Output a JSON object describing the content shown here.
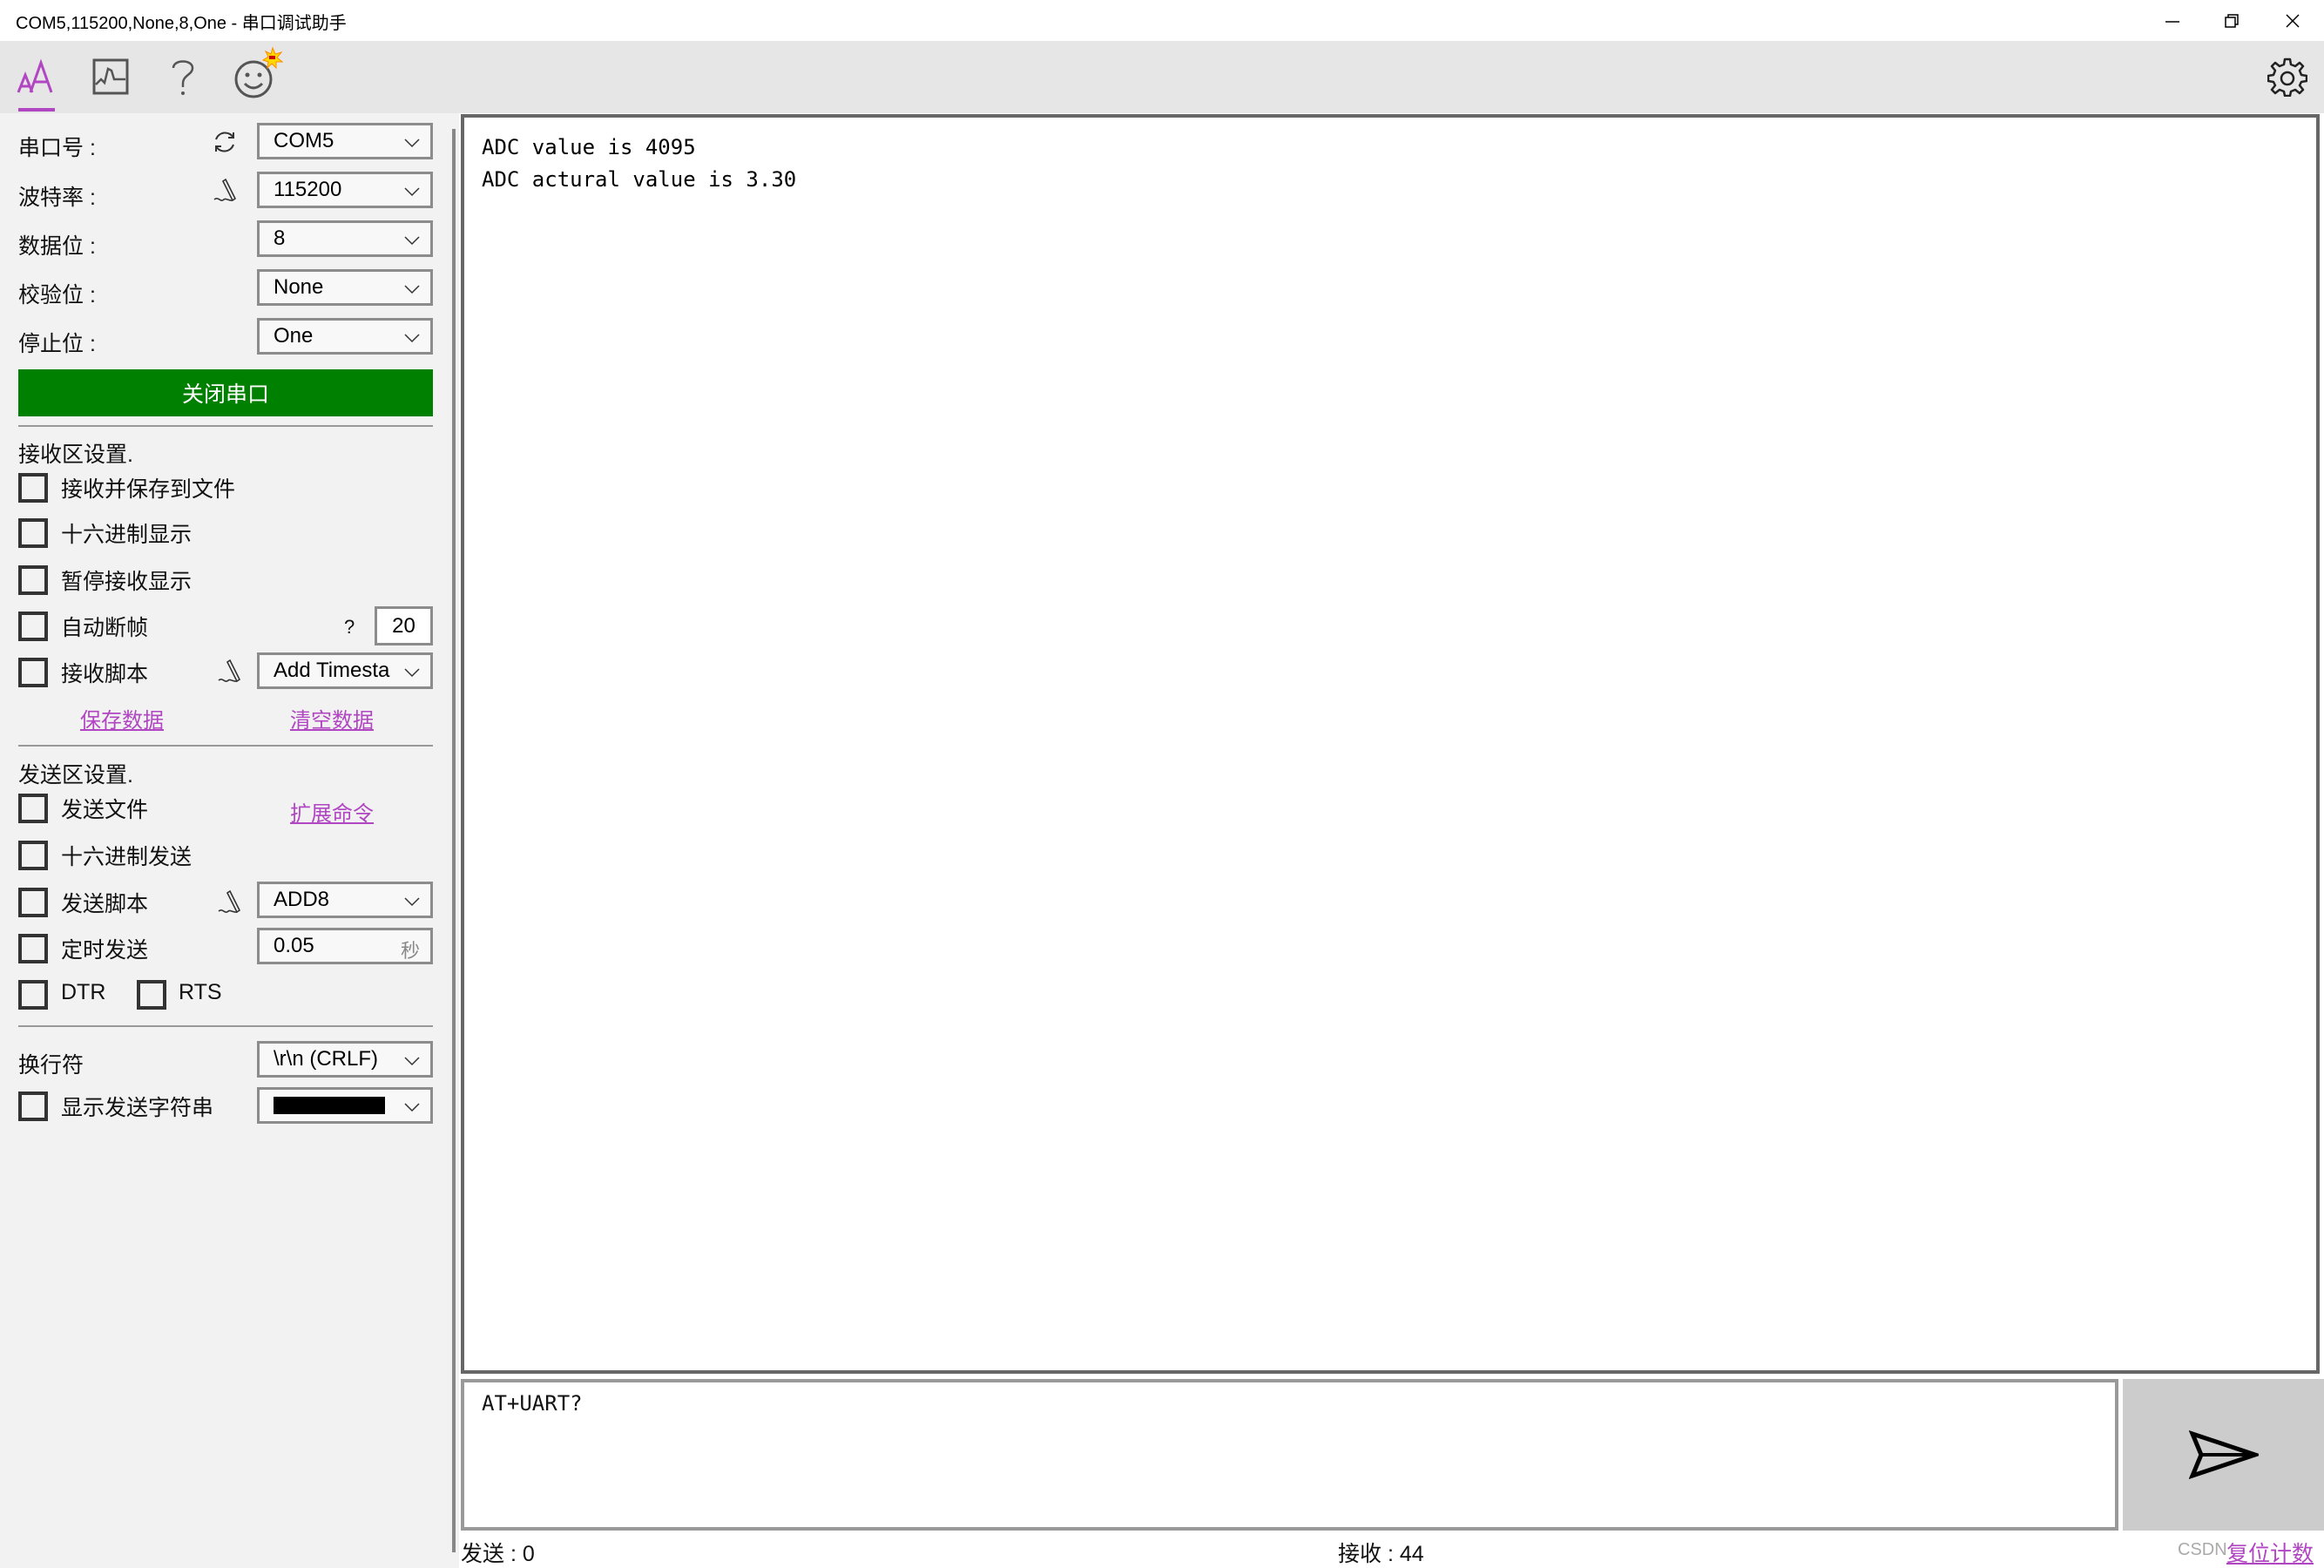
{
  "window": {
    "title": "COM5,115200,None,8,One - 串口调试助手",
    "controls": [
      "minimize",
      "restore",
      "close"
    ]
  },
  "toolbar": {
    "tabs": [
      {
        "name": "text-mode",
        "icon": "font-size-icon",
        "active": true
      },
      {
        "name": "chart-mode",
        "icon": "chart-icon",
        "active": false
      },
      {
        "name": "help",
        "icon": "question-icon",
        "active": false
      },
      {
        "name": "feedback",
        "icon": "smiley-icon",
        "active": false,
        "badge": true
      }
    ],
    "settings_icon": "gear-icon",
    "accent_color": "#b146c2"
  },
  "serial": {
    "port_label": "串口号 :",
    "port_value": "COM5",
    "baud_label": "波特率 :",
    "baud_value": "115200",
    "databits_label": "数据位 :",
    "databits_value": "8",
    "parity_label": "校验位 :",
    "parity_value": "None",
    "stopbits_label": "停止位 :",
    "stopbits_value": "One",
    "toggle_button": "关闭串口",
    "toggle_color": "#008000"
  },
  "receive_settings": {
    "heading": "接收区设置.",
    "save_to_file": "接收并保存到文件",
    "hex_display": "十六进制显示",
    "pause_display": "暂停接收显示",
    "auto_frame": "自动断帧",
    "auto_frame_help": "?",
    "auto_frame_value": "20",
    "script": "接收脚本",
    "script_value": "Add Timesta",
    "save_data": "保存数据",
    "clear_data": "清空数据"
  },
  "send_settings": {
    "heading": "发送区设置.",
    "send_file": "发送文件",
    "ext_commands": "扩展命令",
    "hex_send": "十六进制发送",
    "script": "发送脚本",
    "script_value": "ADD8",
    "timed_send": "定时发送",
    "timed_value": "0.05",
    "timed_unit": "秒",
    "dtr": "DTR",
    "rts": "RTS",
    "newline_label": "换行符",
    "newline_value": "\\r\\n (CRLF)",
    "show_sent": "显示发送字符串",
    "show_sent_color": "#000000"
  },
  "receive": {
    "lines": [
      "ADC value is 4095",
      "ADC actural value is 3.30"
    ]
  },
  "send": {
    "input_value": "AT+UART?",
    "send_icon": "send-icon"
  },
  "status": {
    "sent": "发送 : 0",
    "received": "接收 : 44",
    "reset": "复位计数",
    "watermark": "CSDN"
  }
}
